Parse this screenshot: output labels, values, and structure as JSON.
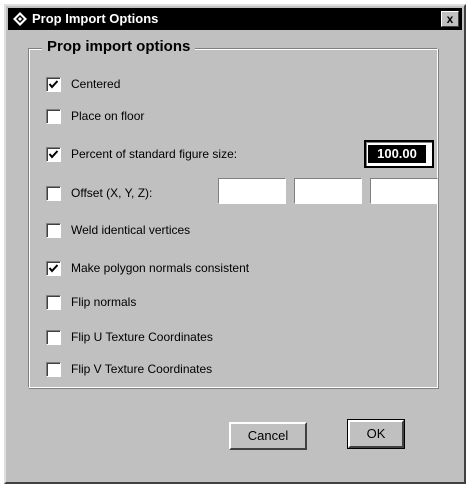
{
  "window": {
    "title": "Prop Import Options",
    "close_label": "x"
  },
  "group": {
    "title": "Prop import options"
  },
  "options": [
    {
      "label": "Centered",
      "checked": true
    },
    {
      "label": "Place on floor",
      "checked": false
    },
    {
      "label": "Percent of standard figure size:",
      "checked": true
    },
    {
      "label": "Offset (X, Y, Z):",
      "checked": false
    },
    {
      "label": "Weld identical vertices",
      "checked": false
    },
    {
      "label": "Make polygon normals consistent",
      "checked": true
    },
    {
      "label": "Flip normals",
      "checked": false
    },
    {
      "label": "Flip U Texture Coordinates",
      "checked": false
    },
    {
      "label": "Flip V Texture Coordinates",
      "checked": false
    }
  ],
  "percent": {
    "value": "100.00"
  },
  "offset": {
    "x": "",
    "y": "",
    "z": ""
  },
  "buttons": {
    "cancel": "Cancel",
    "ok": "OK"
  },
  "icons": {
    "title": "diamond-app-icon",
    "check": "checkmark-icon"
  }
}
